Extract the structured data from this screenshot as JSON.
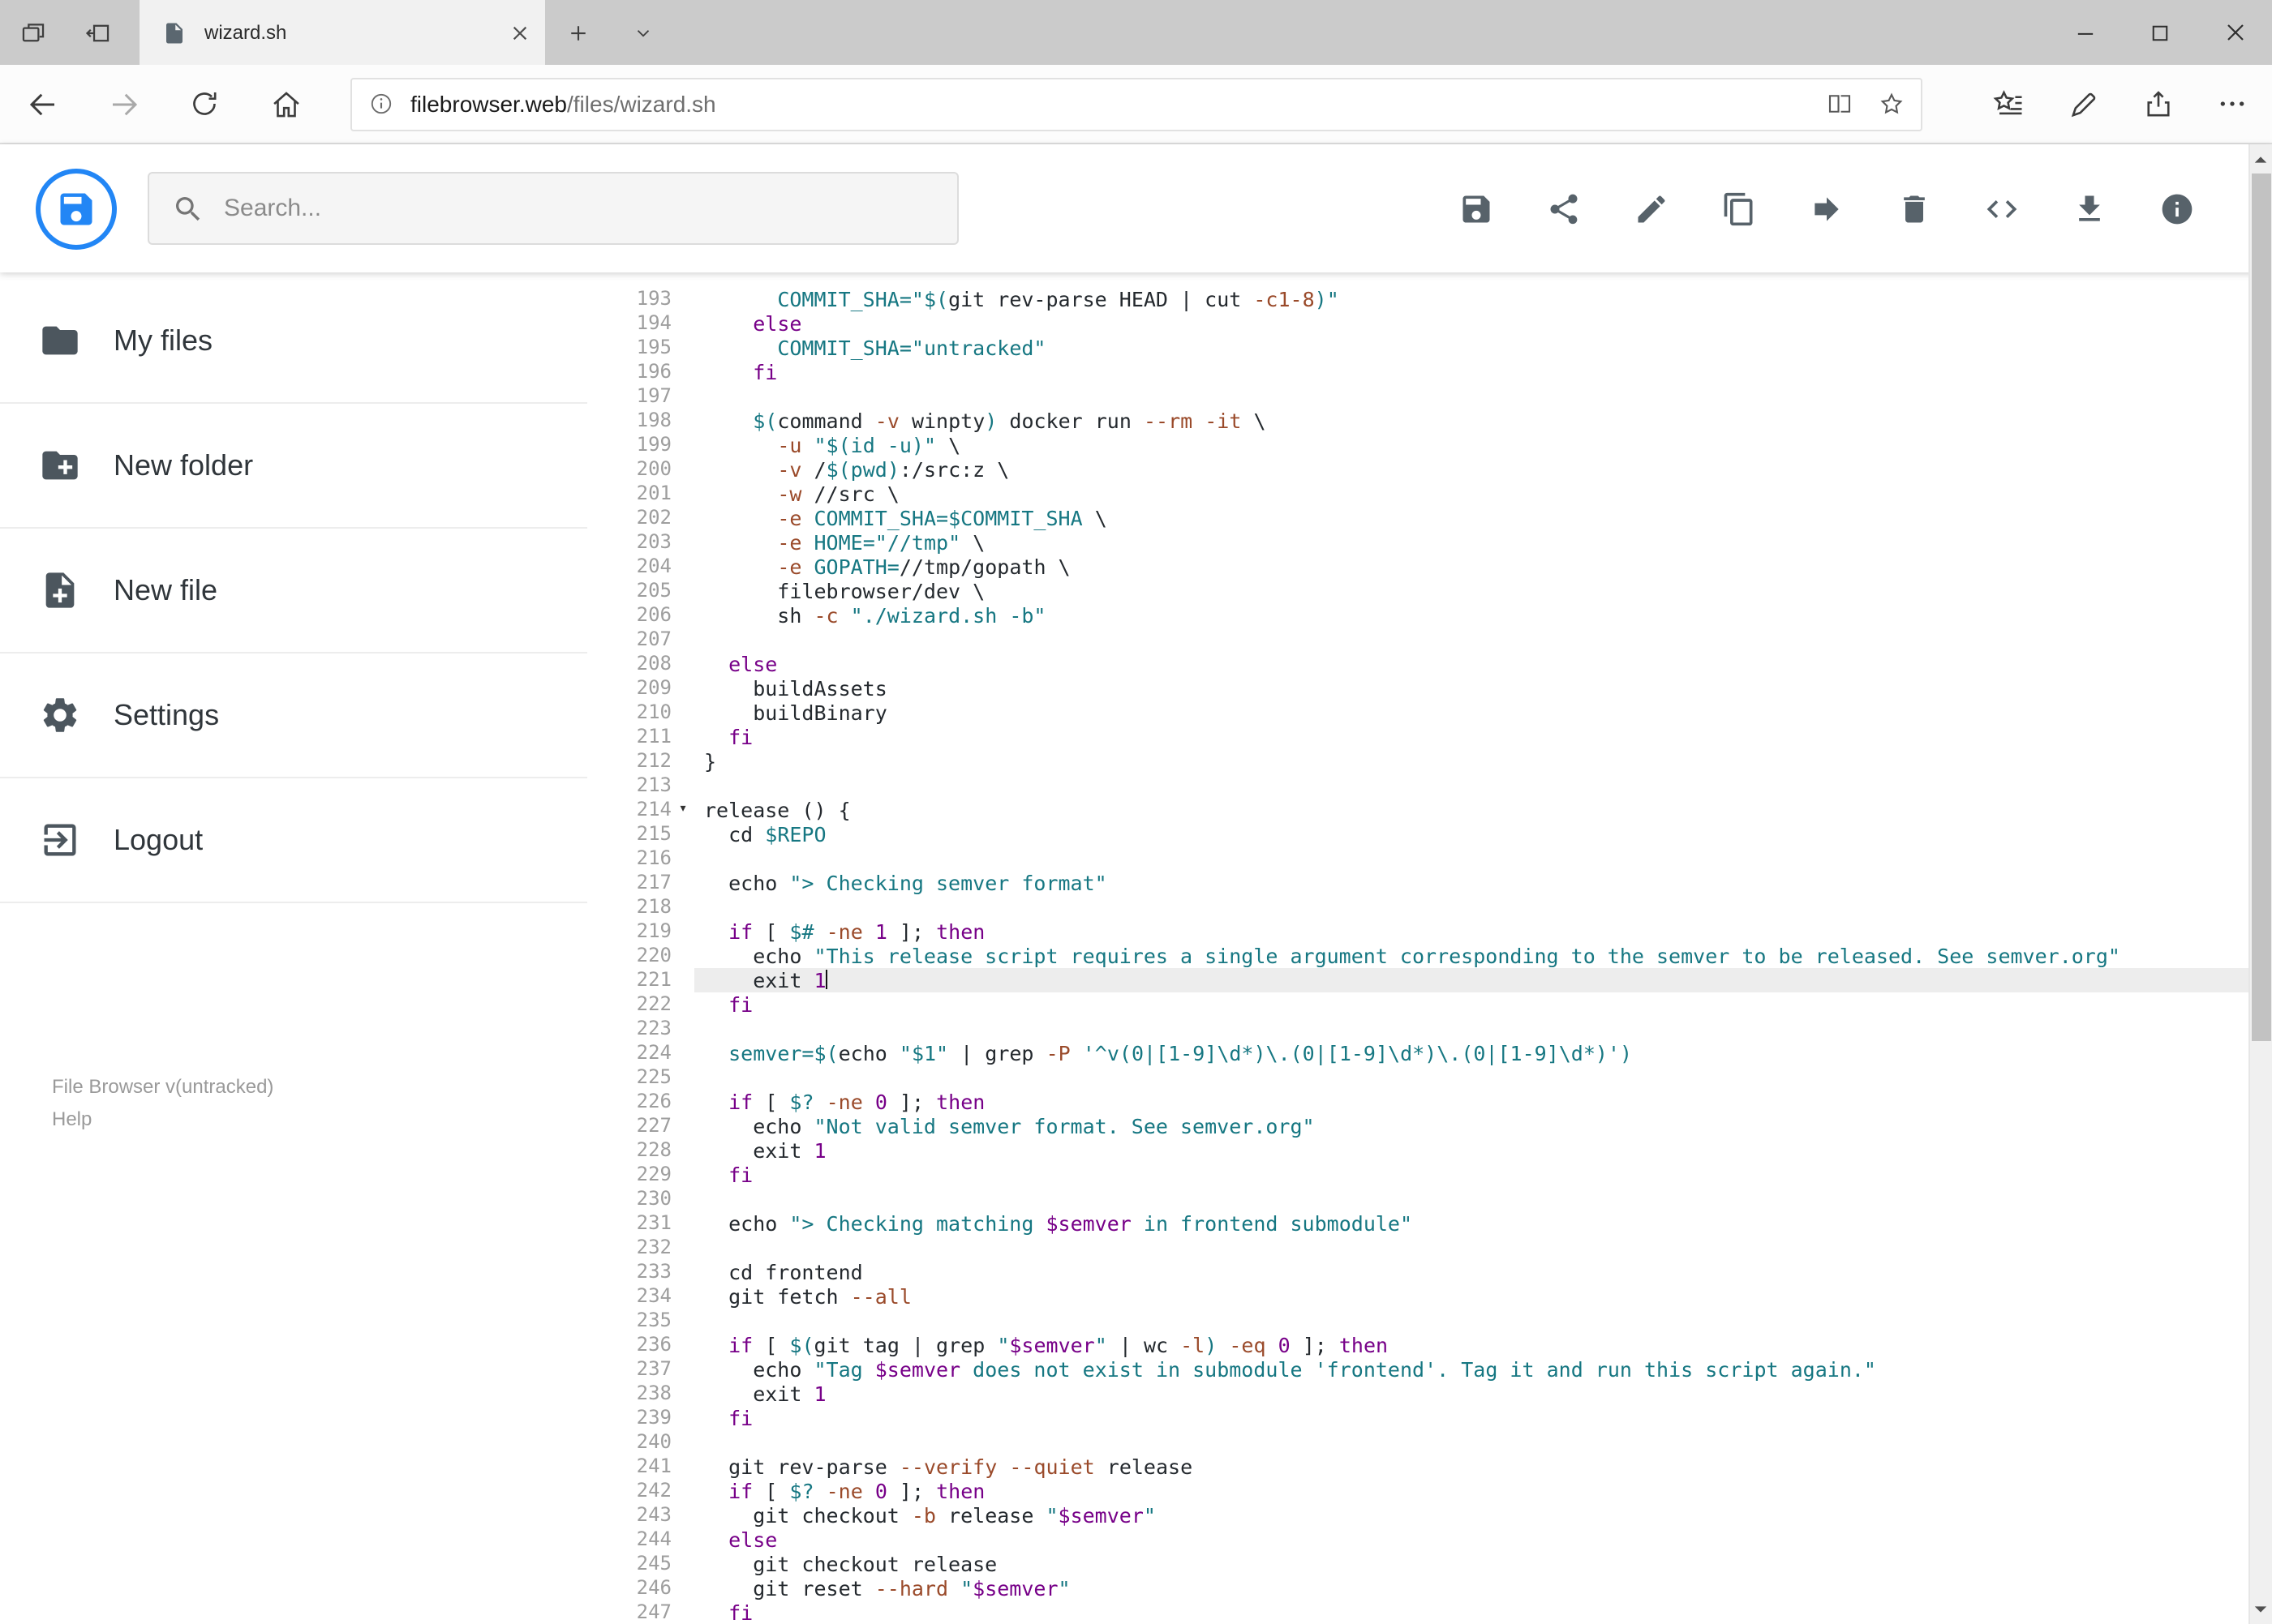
{
  "browser": {
    "tab_title": "wizard.sh",
    "url_domain": "filebrowser.web",
    "url_path": "/files/wizard.sh"
  },
  "toolbar": {
    "search_placeholder": "Search...",
    "actions": [
      {
        "name": "save",
        "icon": "save-icon"
      },
      {
        "name": "share",
        "icon": "share-icon"
      },
      {
        "name": "rename",
        "icon": "pencil-icon"
      },
      {
        "name": "copy",
        "icon": "copy-icon"
      },
      {
        "name": "move",
        "icon": "forward-arrow-icon"
      },
      {
        "name": "delete",
        "icon": "trash-icon"
      },
      {
        "name": "raw-view",
        "icon": "code-icon"
      },
      {
        "name": "download",
        "icon": "download-icon"
      },
      {
        "name": "info",
        "icon": "info-icon"
      }
    ]
  },
  "sidebar": {
    "items": [
      {
        "label": "My files",
        "icon": "folder-icon"
      },
      {
        "label": "New folder",
        "icon": "new-folder-icon"
      },
      {
        "label": "New file",
        "icon": "new-file-icon"
      },
      {
        "label": "Settings",
        "icon": "settings-gear-icon"
      },
      {
        "label": "Logout",
        "icon": "logout-icon"
      }
    ],
    "footer": {
      "version": "File Browser v(untracked)",
      "help": "Help"
    }
  },
  "editor": {
    "active_line": 221,
    "cursor_line": 221,
    "fold_marker_lines": [
      214
    ],
    "fold_marker_glyph": "▾",
    "lines": [
      {
        "n": 193,
        "s": [
          [
            "p",
            "      "
          ],
          [
            "v",
            "COMMIT_SHA="
          ],
          [
            "s",
            "\"$("
          ],
          [
            "p",
            "git rev-parse HEAD | cut "
          ],
          [
            "o",
            "-c1-8"
          ],
          [
            "s",
            ")\""
          ]
        ]
      },
      {
        "n": 194,
        "s": [
          [
            "p",
            "    "
          ],
          [
            "k",
            "else"
          ]
        ]
      },
      {
        "n": 195,
        "s": [
          [
            "p",
            "      "
          ],
          [
            "v",
            "COMMIT_SHA="
          ],
          [
            "s",
            "\"untracked\""
          ]
        ]
      },
      {
        "n": 196,
        "s": [
          [
            "p",
            "    "
          ],
          [
            "k",
            "fi"
          ]
        ]
      },
      {
        "n": 197,
        "s": []
      },
      {
        "n": 198,
        "s": [
          [
            "p",
            "    "
          ],
          [
            "s",
            "$("
          ],
          [
            "p",
            "command "
          ],
          [
            "o",
            "-v"
          ],
          [
            "p",
            " winpty"
          ],
          [
            "s",
            ")"
          ],
          [
            "p",
            " docker run "
          ],
          [
            "o",
            "--rm"
          ],
          [
            "p",
            " "
          ],
          [
            "o",
            "-it"
          ],
          [
            "p",
            " \\"
          ]
        ]
      },
      {
        "n": 199,
        "s": [
          [
            "p",
            "      "
          ],
          [
            "o",
            "-u"
          ],
          [
            "p",
            " "
          ],
          [
            "s",
            "\"$(id -u)\""
          ],
          [
            "p",
            " \\"
          ]
        ]
      },
      {
        "n": 200,
        "s": [
          [
            "p",
            "      "
          ],
          [
            "o",
            "-v"
          ],
          [
            "p",
            " /"
          ],
          [
            "s",
            "$(pwd)"
          ],
          [
            "p",
            ":/src:z \\"
          ]
        ]
      },
      {
        "n": 201,
        "s": [
          [
            "p",
            "      "
          ],
          [
            "o",
            "-w"
          ],
          [
            "p",
            " //src \\"
          ]
        ]
      },
      {
        "n": 202,
        "s": [
          [
            "p",
            "      "
          ],
          [
            "o",
            "-e"
          ],
          [
            "p",
            " "
          ],
          [
            "v",
            "COMMIT_SHA=$COMMIT_SHA"
          ],
          [
            "p",
            " \\"
          ]
        ]
      },
      {
        "n": 203,
        "s": [
          [
            "p",
            "      "
          ],
          [
            "o",
            "-e"
          ],
          [
            "p",
            " "
          ],
          [
            "v",
            "HOME="
          ],
          [
            "s",
            "\"//tmp\""
          ],
          [
            "p",
            " \\"
          ]
        ]
      },
      {
        "n": 204,
        "s": [
          [
            "p",
            "      "
          ],
          [
            "o",
            "-e"
          ],
          [
            "p",
            " "
          ],
          [
            "v",
            "GOPATH="
          ],
          [
            "p",
            "//tmp/gopath \\"
          ]
        ]
      },
      {
        "n": 205,
        "s": [
          [
            "p",
            "      filebrowser/dev \\"
          ]
        ]
      },
      {
        "n": 206,
        "s": [
          [
            "p",
            "      sh "
          ],
          [
            "o",
            "-c"
          ],
          [
            "p",
            " "
          ],
          [
            "s",
            "\"./wizard.sh -b\""
          ]
        ]
      },
      {
        "n": 207,
        "s": []
      },
      {
        "n": 208,
        "s": [
          [
            "p",
            "  "
          ],
          [
            "k",
            "else"
          ]
        ]
      },
      {
        "n": 209,
        "s": [
          [
            "p",
            "    buildAssets"
          ]
        ]
      },
      {
        "n": 210,
        "s": [
          [
            "p",
            "    buildBinary"
          ]
        ]
      },
      {
        "n": 211,
        "s": [
          [
            "p",
            "  "
          ],
          [
            "k",
            "fi"
          ]
        ]
      },
      {
        "n": 212,
        "s": [
          [
            "p",
            "}"
          ]
        ]
      },
      {
        "n": 213,
        "s": []
      },
      {
        "n": 214,
        "s": [
          [
            "p",
            "release () {"
          ]
        ]
      },
      {
        "n": 215,
        "s": [
          [
            "p",
            "  cd "
          ],
          [
            "v",
            "$REPO"
          ]
        ]
      },
      {
        "n": 216,
        "s": []
      },
      {
        "n": 217,
        "s": [
          [
            "p",
            "  echo "
          ],
          [
            "s",
            "\"> Checking semver format\""
          ]
        ]
      },
      {
        "n": 218,
        "s": []
      },
      {
        "n": 219,
        "s": [
          [
            "p",
            "  "
          ],
          [
            "k",
            "if"
          ],
          [
            "p",
            " [ "
          ],
          [
            "v",
            "$#"
          ],
          [
            "p",
            " "
          ],
          [
            "o",
            "-ne"
          ],
          [
            "p",
            " "
          ],
          [
            "n",
            "1"
          ],
          [
            "p",
            " ]; "
          ],
          [
            "k",
            "then"
          ]
        ]
      },
      {
        "n": 220,
        "s": [
          [
            "p",
            "    echo "
          ],
          [
            "s",
            "\"This release script requires a single argument corresponding to the semver to be released. See semver.org\""
          ]
        ]
      },
      {
        "n": 221,
        "s": [
          [
            "p",
            "    exit "
          ],
          [
            "n",
            "1"
          ]
        ]
      },
      {
        "n": 222,
        "s": [
          [
            "p",
            "  "
          ],
          [
            "k",
            "fi"
          ]
        ]
      },
      {
        "n": 223,
        "s": []
      },
      {
        "n": 224,
        "s": [
          [
            "p",
            "  "
          ],
          [
            "v",
            "semver="
          ],
          [
            "s",
            "$("
          ],
          [
            "p",
            "echo "
          ],
          [
            "s",
            "\"$1\""
          ],
          [
            "p",
            " | grep "
          ],
          [
            "o",
            "-P"
          ],
          [
            "p",
            " "
          ],
          [
            "s",
            "'^v(0|[1-9]\\d*)\\.(0|[1-9]\\d*)\\.(0|[1-9]\\d*)'"
          ],
          [
            "s",
            ")"
          ]
        ]
      },
      {
        "n": 225,
        "s": []
      },
      {
        "n": 226,
        "s": [
          [
            "p",
            "  "
          ],
          [
            "k",
            "if"
          ],
          [
            "p",
            " [ "
          ],
          [
            "v",
            "$?"
          ],
          [
            "p",
            " "
          ],
          [
            "o",
            "-ne"
          ],
          [
            "p",
            " "
          ],
          [
            "n",
            "0"
          ],
          [
            "p",
            " ]; "
          ],
          [
            "k",
            "then"
          ]
        ]
      },
      {
        "n": 227,
        "s": [
          [
            "p",
            "    echo "
          ],
          [
            "s",
            "\"Not valid semver format. See semver.org\""
          ]
        ]
      },
      {
        "n": 228,
        "s": [
          [
            "p",
            "    exit "
          ],
          [
            "n",
            "1"
          ]
        ]
      },
      {
        "n": 229,
        "s": [
          [
            "p",
            "  "
          ],
          [
            "k",
            "fi"
          ]
        ]
      },
      {
        "n": 230,
        "s": []
      },
      {
        "n": 231,
        "s": [
          [
            "p",
            "  echo "
          ],
          [
            "s",
            "\"> Checking matching "
          ],
          [
            "w",
            "$semver"
          ],
          [
            "s",
            " in frontend submodule\""
          ]
        ]
      },
      {
        "n": 232,
        "s": []
      },
      {
        "n": 233,
        "s": [
          [
            "p",
            "  cd frontend"
          ]
        ]
      },
      {
        "n": 234,
        "s": [
          [
            "p",
            "  git fetch "
          ],
          [
            "o",
            "--all"
          ]
        ]
      },
      {
        "n": 235,
        "s": []
      },
      {
        "n": 236,
        "s": [
          [
            "p",
            "  "
          ],
          [
            "k",
            "if"
          ],
          [
            "p",
            " [ "
          ],
          [
            "s",
            "$("
          ],
          [
            "p",
            "git tag | grep "
          ],
          [
            "s",
            "\""
          ],
          [
            "w",
            "$semver"
          ],
          [
            "s",
            "\""
          ],
          [
            "p",
            " | wc "
          ],
          [
            "o",
            "-l"
          ],
          [
            "s",
            ")"
          ],
          [
            "p",
            " "
          ],
          [
            "o",
            "-eq"
          ],
          [
            "p",
            " "
          ],
          [
            "n",
            "0"
          ],
          [
            "p",
            " ]; "
          ],
          [
            "k",
            "then"
          ]
        ]
      },
      {
        "n": 237,
        "s": [
          [
            "p",
            "    echo "
          ],
          [
            "s",
            "\"Tag "
          ],
          [
            "w",
            "$semver"
          ],
          [
            "s",
            " does not exist in submodule 'frontend'. Tag it and run this script again.\""
          ]
        ]
      },
      {
        "n": 238,
        "s": [
          [
            "p",
            "    exit "
          ],
          [
            "n",
            "1"
          ]
        ]
      },
      {
        "n": 239,
        "s": [
          [
            "p",
            "  "
          ],
          [
            "k",
            "fi"
          ]
        ]
      },
      {
        "n": 240,
        "s": []
      },
      {
        "n": 241,
        "s": [
          [
            "p",
            "  git rev-parse "
          ],
          [
            "o",
            "--verify"
          ],
          [
            "p",
            " "
          ],
          [
            "o",
            "--quiet"
          ],
          [
            "p",
            " release"
          ]
        ]
      },
      {
        "n": 242,
        "s": [
          [
            "p",
            "  "
          ],
          [
            "k",
            "if"
          ],
          [
            "p",
            " [ "
          ],
          [
            "v",
            "$?"
          ],
          [
            "p",
            " "
          ],
          [
            "o",
            "-ne"
          ],
          [
            "p",
            " "
          ],
          [
            "n",
            "0"
          ],
          [
            "p",
            " ]; "
          ],
          [
            "k",
            "then"
          ]
        ]
      },
      {
        "n": 243,
        "s": [
          [
            "p",
            "    git checkout "
          ],
          [
            "o",
            "-b"
          ],
          [
            "p",
            " release "
          ],
          [
            "s",
            "\""
          ],
          [
            "w",
            "$semver"
          ],
          [
            "s",
            "\""
          ]
        ]
      },
      {
        "n": 244,
        "s": [
          [
            "p",
            "  "
          ],
          [
            "k",
            "else"
          ]
        ]
      },
      {
        "n": 245,
        "s": [
          [
            "p",
            "    git checkout release"
          ]
        ]
      },
      {
        "n": 246,
        "s": [
          [
            "p",
            "    git reset "
          ],
          [
            "o",
            "--hard"
          ],
          [
            "p",
            " "
          ],
          [
            "s",
            "\""
          ],
          [
            "w",
            "$semver"
          ],
          [
            "s",
            "\""
          ]
        ]
      },
      {
        "n": 247,
        "s": [
          [
            "p",
            "  "
          ],
          [
            "k",
            "fi"
          ]
        ]
      }
    ]
  },
  "colors": {
    "accent": "#2286f5",
    "plain": "#24292e",
    "keyword": "#770088",
    "string": "#167782",
    "variable": "#167782",
    "var_in_string": "#770088",
    "number": "#770088",
    "option": "#9a4a2a",
    "active_line_bg": "#ededed",
    "line_number": "#9e9e9e"
  }
}
